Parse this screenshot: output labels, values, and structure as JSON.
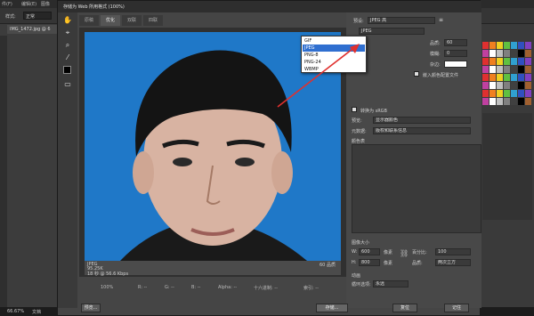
{
  "ps": {
    "menu": [
      "件(F)",
      "编辑(E)",
      "图像"
    ],
    "option_label": "样式:",
    "option_value": "正常",
    "doc_tab": "IMG_1472.jpg @ 6",
    "zoom_status": "66.67%",
    "status_doc": "文档"
  },
  "dialog": {
    "title": "存储为 Web 所用格式 (100%)",
    "tabs": [
      "原稿",
      "优化",
      "双联",
      "四联"
    ],
    "info": {
      "format": "JPEG",
      "size": "95.25K",
      "time": "18 秒 @ 56.6 Kbps",
      "quality": "60 品质"
    },
    "bottom": {
      "zoom": "100%",
      "r": "R: --",
      "g": "G: --",
      "b": "B: --",
      "alpha": "Alpha: --",
      "hex": "十六进制: --",
      "index": "索引: --"
    },
    "buttons": {
      "preview": "预览...",
      "save": "存储...",
      "reset": "复位",
      "remember": "记住"
    }
  },
  "settings": {
    "preset_label": "预设:",
    "preset_value": "JPEG 高",
    "format_value": "JPEG",
    "quality_label": "品质:",
    "quality_value": "60",
    "blur_label": "模糊:",
    "blur_value": "0",
    "matte_label": "杂边:",
    "embed_profile": "嵌入颜色配置文件",
    "convert_srgb": "转换为 sRGB",
    "preview_label": "预览:",
    "preview_value": "显示器颜色",
    "metadata_label": "元数据:",
    "metadata_value": "版权和联系信息",
    "color_table": "颜色表",
    "image_size": "图像大小",
    "w_label": "W:",
    "w_value": "600",
    "h_label": "H:",
    "h_value": "800",
    "unit": "像素",
    "percent_label": "百分比:",
    "percent_value": "100",
    "quality2_label": "品质:",
    "quality2_value": "两次立方",
    "animation": "动画",
    "loop_label": "循环选项:",
    "loop_value": "永远"
  },
  "format_options": [
    "GIF",
    "JPEG",
    "PNG-8",
    "PNG-24",
    "WBMP"
  ],
  "colors": {
    "photo_bg": "#1f78c8",
    "accent_arrow": "#e0302e",
    "selection": "#2f6fd0"
  }
}
